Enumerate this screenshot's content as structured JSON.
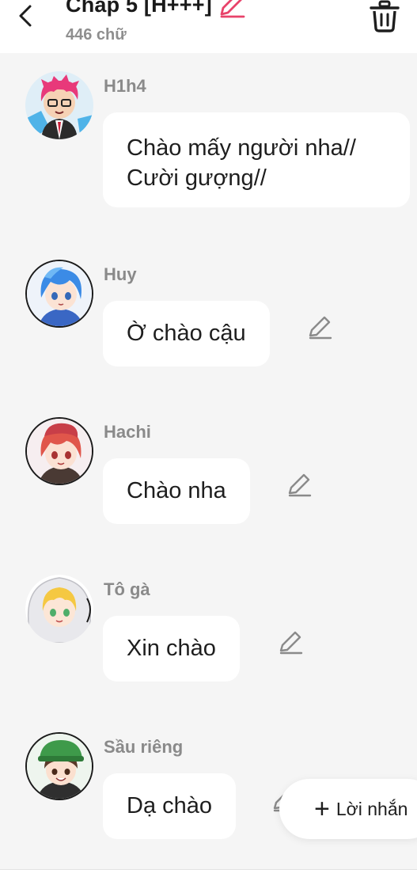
{
  "header": {
    "title": "Chap 5 [H+++]",
    "word_count": "446 chữ",
    "accent_color": "#e8436a"
  },
  "messages": [
    {
      "name": "H1h4",
      "text": "Chào mấy người nha//\nCười gượng//",
      "avatar": "avatar-h1h4"
    },
    {
      "name": "Huy",
      "text": "Ờ chào cậu",
      "avatar": "avatar-huy"
    },
    {
      "name": "Hachi",
      "text": "Chào nha",
      "avatar": "avatar-hachi"
    },
    {
      "name": "Tô gà",
      "text": "Xin chào",
      "avatar": "avatar-to-ga"
    },
    {
      "name": "Sầu riêng",
      "text": "Dạ chào",
      "avatar": "avatar-sau-rieng"
    }
  ],
  "fab": {
    "label": "Lời nhắn"
  }
}
